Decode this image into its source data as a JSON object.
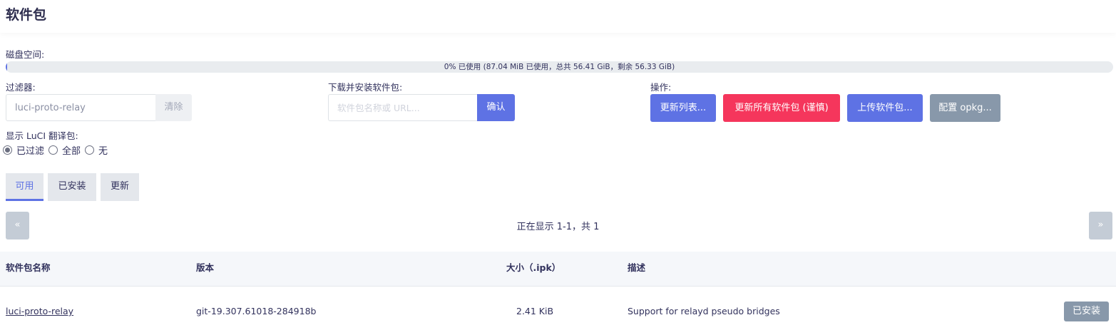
{
  "page": {
    "title": "软件包"
  },
  "disk": {
    "label": "磁盘空间:",
    "used_fraction": 0.0015,
    "text": "0% 已使用 (87.04 MiB 已使用，总共 56.41 GiB，剩余 56.33 GiB)"
  },
  "filter": {
    "label": "过滤器:",
    "value": "luci-proto-relay",
    "clear_label": "清除"
  },
  "download": {
    "label": "下载并安装软件包:",
    "placeholder": "软件包名称或 URL...",
    "confirm_label": "确认"
  },
  "actions": {
    "label": "操作:",
    "update_lists": "更新列表...",
    "upgrade_all": "更新所有软件包 (谨慎)",
    "upload": "上传软件包...",
    "configure": "配置 opkg..."
  },
  "translations": {
    "label": "显示 LuCI 翻译包:",
    "options": [
      "已过滤",
      "全部",
      "无"
    ],
    "selected": "已过滤"
  },
  "tabs": [
    {
      "label": "可用",
      "active": true
    },
    {
      "label": "已安装",
      "active": false
    },
    {
      "label": "更新",
      "active": false
    }
  ],
  "pager": {
    "prev": "«",
    "next": "»",
    "text": "正在显示 1-1，共 1"
  },
  "table": {
    "headers": [
      "软件包名称",
      "版本",
      "大小（.ipk）",
      "描述"
    ],
    "rows": [
      {
        "name": "luci-proto-relay",
        "version": "git-19.307.61018-284918b",
        "size": "2.41 KiB",
        "description": "Support for relayd pseudo bridges",
        "action": "已安装"
      }
    ]
  },
  "colors": {
    "primary": "#5e72e4",
    "danger": "#f5365c",
    "secondary": "#8898aa"
  }
}
